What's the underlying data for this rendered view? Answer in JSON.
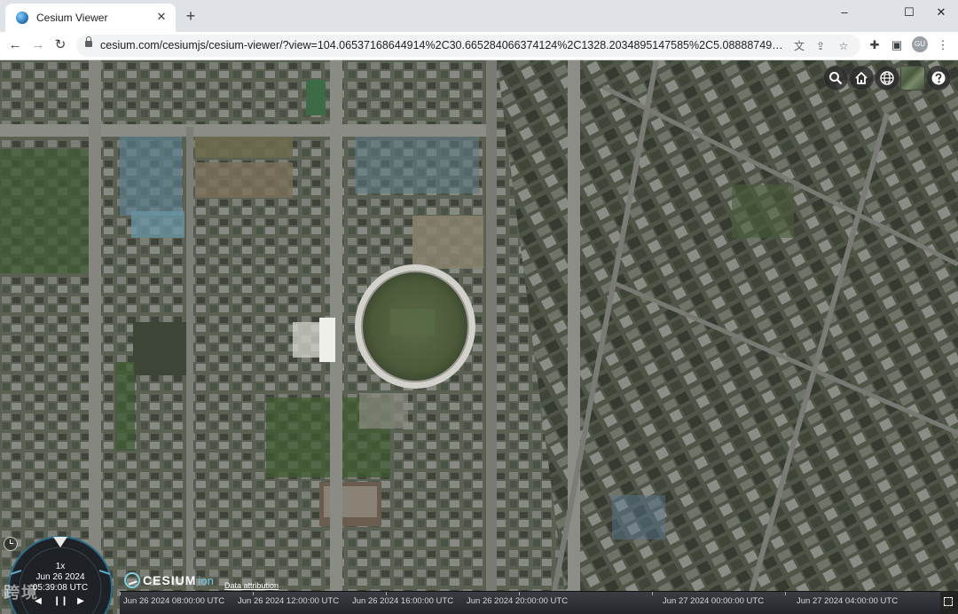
{
  "browser": {
    "tab_title": "Cesium Viewer",
    "tab_close": "✕",
    "new_tab": "+",
    "window_minimize": "–",
    "window_restore": "☐",
    "window_close": "✕",
    "url": "cesium.com/cesiumjs/cesium-viewer/?view=104.06537168644914%2C30.665284066374124%2C1328.2034895147585%2C5.088887490341627e...",
    "profile_initials": "GU"
  },
  "viewer": {
    "speed": "1x",
    "date": "Jun 26 2024",
    "time": "05:39:08 UTC",
    "logo_text": "CESIUM",
    "logo_suffix": "ion",
    "attribution": "Data attribution",
    "watermark": "跨境",
    "timeline_labels": [
      "Jun 26 2024 08:00:00 UTC",
      "Jun 26 2024 12:00:00 UTC",
      "Jun 26 2024 16:00:00 UTC",
      "Jun 26 2024 20:00:00 UTC",
      "Jun 27 2024 00:00:00 UTC",
      "Jun 27 2024 04:00:00 UTC"
    ]
  },
  "icons": {
    "back": "arrow-left-icon",
    "forward": "arrow-right-icon",
    "reload": "reload-icon",
    "search": "search-icon",
    "home": "home-icon",
    "scene_mode": "globe-icon",
    "help": "help-icon"
  }
}
